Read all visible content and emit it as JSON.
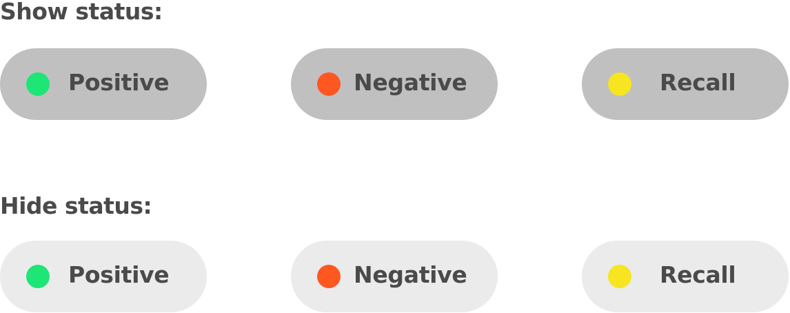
{
  "sections": [
    {
      "title": "Show status:",
      "state": "active",
      "pill_background": "#c0c0c0",
      "pills": [
        {
          "label": "Positive",
          "dot_color": "#1de576",
          "dot_icon": "status-dot-icon"
        },
        {
          "label": "Negative",
          "dot_color": "#ff5722",
          "dot_icon": "status-dot-icon"
        },
        {
          "label": "Recall",
          "dot_color": "#f7e521",
          "dot_icon": "status-dot-icon"
        }
      ]
    },
    {
      "title": "Hide status:",
      "state": "inactive",
      "pill_background": "#ebebeb",
      "pills": [
        {
          "label": "Positive",
          "dot_color": "#1de576",
          "dot_icon": "status-dot-icon"
        },
        {
          "label": "Negative",
          "dot_color": "#ff5722",
          "dot_icon": "status-dot-icon"
        },
        {
          "label": "Recall",
          "dot_color": "#f7e521",
          "dot_icon": "status-dot-icon"
        }
      ]
    }
  ],
  "colors": {
    "text": "#4a4a4a",
    "positive": "#1de576",
    "negative": "#ff5722",
    "recall": "#f7e521"
  }
}
